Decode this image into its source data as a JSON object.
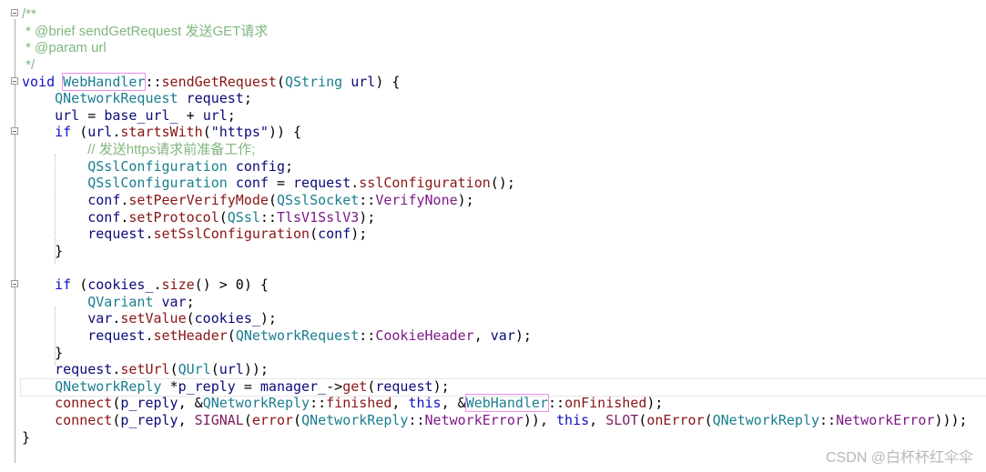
{
  "editor": {
    "lines": [
      {
        "fold": true,
        "tokens": [
          [
            "/**",
            "c"
          ]
        ]
      },
      {
        "tokens": [
          [
            " * @brief sendGetRequest 发送GET请求",
            "c"
          ]
        ]
      },
      {
        "tokens": [
          [
            " * @param url",
            "c"
          ]
        ]
      },
      {
        "tokens": [
          [
            " */",
            "c"
          ]
        ]
      },
      {
        "fold": true,
        "tokens": [
          [
            "void",
            "k"
          ],
          [
            " ",
            "p"
          ],
          [
            "WebHandler",
            "t",
            "hl"
          ],
          [
            "::",
            "p"
          ],
          [
            "sendGetRequest",
            "f"
          ],
          [
            "(",
            "p"
          ],
          [
            "QString",
            "t"
          ],
          [
            " ",
            "p"
          ],
          [
            "url",
            "v"
          ],
          [
            ") {",
            "p"
          ]
        ]
      },
      {
        "tokens": [
          [
            "    ",
            "p"
          ],
          [
            "QNetworkRequest",
            "t"
          ],
          [
            " ",
            "p"
          ],
          [
            "request",
            "v"
          ],
          [
            ";",
            "p"
          ]
        ]
      },
      {
        "tokens": [
          [
            "    ",
            "p"
          ],
          [
            "url",
            "v"
          ],
          [
            " = ",
            "p"
          ],
          [
            "base_url_",
            "v"
          ],
          [
            " + ",
            "p"
          ],
          [
            "url",
            "v"
          ],
          [
            ";",
            "p"
          ]
        ]
      },
      {
        "fold": true,
        "tokens": [
          [
            "    ",
            "p"
          ],
          [
            "if",
            "k"
          ],
          [
            " (",
            "p"
          ],
          [
            "url",
            "v"
          ],
          [
            ".",
            "p"
          ],
          [
            "startsWith",
            "f"
          ],
          [
            "(",
            "p"
          ],
          [
            "\"https\"",
            "s"
          ],
          [
            ")) {",
            "p"
          ]
        ]
      },
      {
        "tokens": [
          [
            "        ",
            "p"
          ],
          [
            "// 发送https请求前准备工作;",
            "c"
          ]
        ]
      },
      {
        "tokens": [
          [
            "        ",
            "p"
          ],
          [
            "QSslConfiguration",
            "t"
          ],
          [
            " ",
            "p"
          ],
          [
            "config",
            "v"
          ],
          [
            ";",
            "p"
          ]
        ]
      },
      {
        "tokens": [
          [
            "        ",
            "p"
          ],
          [
            "QSslConfiguration",
            "t"
          ],
          [
            " ",
            "p"
          ],
          [
            "conf",
            "v"
          ],
          [
            " = ",
            "p"
          ],
          [
            "request",
            "v"
          ],
          [
            ".",
            "p"
          ],
          [
            "sslConfiguration",
            "f"
          ],
          [
            "();",
            "p"
          ]
        ]
      },
      {
        "tokens": [
          [
            "        ",
            "p"
          ],
          [
            "conf",
            "v"
          ],
          [
            ".",
            "p"
          ],
          [
            "setPeerVerifyMode",
            "f"
          ],
          [
            "(",
            "p"
          ],
          [
            "QSslSocket",
            "t"
          ],
          [
            "::",
            "p"
          ],
          [
            "VerifyNone",
            "e"
          ],
          [
            ");",
            "p"
          ]
        ]
      },
      {
        "tokens": [
          [
            "        ",
            "p"
          ],
          [
            "conf",
            "v"
          ],
          [
            ".",
            "p"
          ],
          [
            "setProtocol",
            "f"
          ],
          [
            "(",
            "p"
          ],
          [
            "QSsl",
            "t"
          ],
          [
            "::",
            "p"
          ],
          [
            "TlsV1SslV3",
            "e"
          ],
          [
            ");",
            "p"
          ]
        ]
      },
      {
        "tokens": [
          [
            "        ",
            "p"
          ],
          [
            "request",
            "v"
          ],
          [
            ".",
            "p"
          ],
          [
            "setSslConfiguration",
            "f"
          ],
          [
            "(",
            "p"
          ],
          [
            "conf",
            "v"
          ],
          [
            ");",
            "p"
          ]
        ]
      },
      {
        "tokens": [
          [
            "    }",
            "p"
          ]
        ]
      },
      {
        "tokens": []
      },
      {
        "fold": true,
        "tokens": [
          [
            "    ",
            "p"
          ],
          [
            "if",
            "k"
          ],
          [
            " (",
            "p"
          ],
          [
            "cookies_",
            "v"
          ],
          [
            ".",
            "p"
          ],
          [
            "size",
            "f"
          ],
          [
            "() > 0) {",
            "p"
          ]
        ]
      },
      {
        "tokens": [
          [
            "        ",
            "p"
          ],
          [
            "QVariant",
            "t"
          ],
          [
            " ",
            "p"
          ],
          [
            "var",
            "v"
          ],
          [
            ";",
            "p"
          ]
        ]
      },
      {
        "tokens": [
          [
            "        ",
            "p"
          ],
          [
            "var",
            "v"
          ],
          [
            ".",
            "p"
          ],
          [
            "setValue",
            "f"
          ],
          [
            "(",
            "p"
          ],
          [
            "cookies_",
            "v"
          ],
          [
            ");",
            "p"
          ]
        ]
      },
      {
        "tokens": [
          [
            "        ",
            "p"
          ],
          [
            "request",
            "v"
          ],
          [
            ".",
            "p"
          ],
          [
            "setHeader",
            "f"
          ],
          [
            "(",
            "p"
          ],
          [
            "QNetworkRequest",
            "t"
          ],
          [
            "::",
            "p"
          ],
          [
            "CookieHeader",
            "e"
          ],
          [
            ", ",
            "p"
          ],
          [
            "var",
            "v"
          ],
          [
            ");",
            "p"
          ]
        ]
      },
      {
        "tokens": [
          [
            "    }",
            "p"
          ]
        ]
      },
      {
        "tokens": [
          [
            "    ",
            "p"
          ],
          [
            "request",
            "v"
          ],
          [
            ".",
            "p"
          ],
          [
            "setUrl",
            "f"
          ],
          [
            "(",
            "p"
          ],
          [
            "QUrl",
            "t"
          ],
          [
            "(",
            "p"
          ],
          [
            "url",
            "v"
          ],
          [
            "));",
            "p"
          ]
        ]
      },
      {
        "current": true,
        "tokens": [
          [
            "    ",
            "p"
          ],
          [
            "QNetworkReply",
            "t"
          ],
          [
            " *",
            "p"
          ],
          [
            "p_reply",
            "v"
          ],
          [
            " = ",
            "p"
          ],
          [
            "manager_",
            "v"
          ],
          [
            "->",
            "p"
          ],
          [
            "get",
            "f"
          ],
          [
            "(",
            "p"
          ],
          [
            "request",
            "v"
          ],
          [
            ");",
            "p"
          ]
        ]
      },
      {
        "tokens": [
          [
            "    ",
            "p"
          ],
          [
            "connect",
            "f"
          ],
          [
            "(",
            "p"
          ],
          [
            "p_reply",
            "v"
          ],
          [
            ", &",
            "p"
          ],
          [
            "QNetworkReply",
            "t"
          ],
          [
            "::",
            "p"
          ],
          [
            "finished",
            "f"
          ],
          [
            ", ",
            "p"
          ],
          [
            "this",
            "k"
          ],
          [
            ", &",
            "p"
          ],
          [
            "WebHandler",
            "t",
            "hl"
          ],
          [
            "::",
            "p"
          ],
          [
            "onFinished",
            "f"
          ],
          [
            ");",
            "p"
          ]
        ]
      },
      {
        "tokens": [
          [
            "    ",
            "p"
          ],
          [
            "connect",
            "f"
          ],
          [
            "(",
            "p"
          ],
          [
            "p_reply",
            "v"
          ],
          [
            ", ",
            "p"
          ],
          [
            "SIGNAL",
            "m"
          ],
          [
            "(",
            "p"
          ],
          [
            "error",
            "f"
          ],
          [
            "(",
            "p"
          ],
          [
            "QNetworkReply",
            "t"
          ],
          [
            "::",
            "p"
          ],
          [
            "NetworkError",
            "e"
          ],
          [
            ")), ",
            "p"
          ],
          [
            "this",
            "k"
          ],
          [
            ", ",
            "p"
          ],
          [
            "SLOT",
            "m"
          ],
          [
            "(",
            "p"
          ],
          [
            "onError",
            "f"
          ],
          [
            "(",
            "p"
          ],
          [
            "QNetworkReply",
            "t"
          ],
          [
            "::",
            "p"
          ],
          [
            "NetworkError",
            "e"
          ],
          [
            ")));",
            "p"
          ]
        ]
      },
      {
        "tokens": [
          [
            "}",
            "p"
          ]
        ]
      }
    ]
  },
  "watermark": "CSDN @白杯杯红伞伞",
  "colors": {
    "keyword": "#1010c8",
    "type": "#1b7e90",
    "variable": "#0a0a78",
    "function": "#8a1515",
    "enum": "#7d1a87",
    "comment": "#7fb77f",
    "highlight_box": "#f08cf0"
  }
}
